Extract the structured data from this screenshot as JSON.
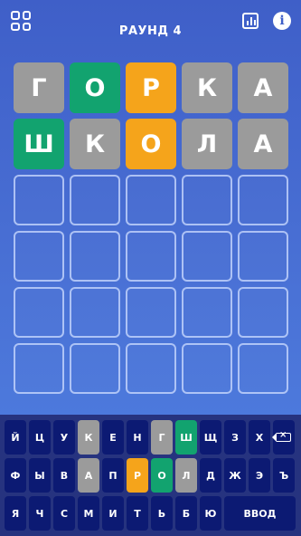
{
  "header": {
    "title": "РАУНД 4",
    "menu_icon": "grid-menu-icon",
    "stats_icon": "bar-chart-icon",
    "info_icon": "info-icon",
    "info_glyph": "i"
  },
  "colors": {
    "absent": "#9b9b9b",
    "present": "#f5a41b",
    "correct": "#12a36f",
    "key_default": "#0c1a73"
  },
  "board": {
    "rows": [
      [
        {
          "letter": "Г",
          "state": "absent"
        },
        {
          "letter": "О",
          "state": "correct"
        },
        {
          "letter": "Р",
          "state": "present"
        },
        {
          "letter": "К",
          "state": "absent"
        },
        {
          "letter": "А",
          "state": "absent"
        }
      ],
      [
        {
          "letter": "Ш",
          "state": "correct"
        },
        {
          "letter": "К",
          "state": "absent"
        },
        {
          "letter": "О",
          "state": "present"
        },
        {
          "letter": "Л",
          "state": "absent"
        },
        {
          "letter": "А",
          "state": "absent"
        }
      ],
      [
        {
          "letter": "",
          "state": "empty"
        },
        {
          "letter": "",
          "state": "empty"
        },
        {
          "letter": "",
          "state": "empty"
        },
        {
          "letter": "",
          "state": "empty"
        },
        {
          "letter": "",
          "state": "empty"
        }
      ],
      [
        {
          "letter": "",
          "state": "empty"
        },
        {
          "letter": "",
          "state": "empty"
        },
        {
          "letter": "",
          "state": "empty"
        },
        {
          "letter": "",
          "state": "empty"
        },
        {
          "letter": "",
          "state": "empty"
        }
      ],
      [
        {
          "letter": "",
          "state": "empty"
        },
        {
          "letter": "",
          "state": "empty"
        },
        {
          "letter": "",
          "state": "empty"
        },
        {
          "letter": "",
          "state": "empty"
        },
        {
          "letter": "",
          "state": "empty"
        }
      ],
      [
        {
          "letter": "",
          "state": "empty"
        },
        {
          "letter": "",
          "state": "empty"
        },
        {
          "letter": "",
          "state": "empty"
        },
        {
          "letter": "",
          "state": "empty"
        },
        {
          "letter": "",
          "state": "empty"
        }
      ]
    ]
  },
  "keyboard": {
    "rows": [
      [
        {
          "label": "Й",
          "state": ""
        },
        {
          "label": "Ц",
          "state": ""
        },
        {
          "label": "У",
          "state": ""
        },
        {
          "label": "К",
          "state": "absent"
        },
        {
          "label": "Е",
          "state": ""
        },
        {
          "label": "Н",
          "state": ""
        },
        {
          "label": "Г",
          "state": "absent"
        },
        {
          "label": "Ш",
          "state": "correct"
        },
        {
          "label": "Щ",
          "state": ""
        },
        {
          "label": "З",
          "state": ""
        },
        {
          "label": "Х",
          "state": ""
        },
        {
          "label": "",
          "state": "",
          "kind": "backspace",
          "icon": "backspace-icon"
        }
      ],
      [
        {
          "label": "Ф",
          "state": ""
        },
        {
          "label": "Ы",
          "state": ""
        },
        {
          "label": "В",
          "state": ""
        },
        {
          "label": "А",
          "state": "absent"
        },
        {
          "label": "П",
          "state": ""
        },
        {
          "label": "Р",
          "state": "present"
        },
        {
          "label": "О",
          "state": "correct"
        },
        {
          "label": "Л",
          "state": "absent"
        },
        {
          "label": "Д",
          "state": ""
        },
        {
          "label": "Ж",
          "state": ""
        },
        {
          "label": "Э",
          "state": ""
        },
        {
          "label": "Ъ",
          "state": ""
        }
      ],
      [
        {
          "label": "Я",
          "state": ""
        },
        {
          "label": "Ч",
          "state": ""
        },
        {
          "label": "С",
          "state": ""
        },
        {
          "label": "М",
          "state": ""
        },
        {
          "label": "И",
          "state": ""
        },
        {
          "label": "Т",
          "state": ""
        },
        {
          "label": "Ь",
          "state": ""
        },
        {
          "label": "Б",
          "state": ""
        },
        {
          "label": "Ю",
          "state": ""
        },
        {
          "label": "ВВОД",
          "state": "",
          "kind": "enter"
        }
      ]
    ]
  }
}
